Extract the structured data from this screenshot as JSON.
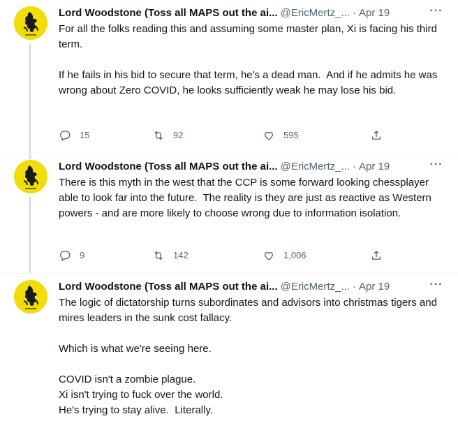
{
  "tweets": [
    {
      "author_name": "Lord Woodstone (Toss all MAPS out the ai...",
      "handle": "@EricMertz_...",
      "separator": "·",
      "time": "Apr 19",
      "more": "···",
      "text": "For all the folks reading this and assuming some master plan, Xi is facing his third term.\n\nIf he fails in his bid to secure that term, he's a dead man.  And if he admits he was wrong about Zero COVID, he looks sufficiently weak he may lose his bid.",
      "replies": "15",
      "retweets": "92",
      "likes": "595"
    },
    {
      "author_name": "Lord Woodstone (Toss all MAPS out the ai...",
      "handle": "@EricMertz_...",
      "separator": "·",
      "time": "Apr 19",
      "more": "···",
      "text": "There is this myth in the west that the CCP is some forward looking chessplayer able to look far into the future.  The reality is they are just as reactive as Western powers - and are more likely to choose wrong due to information isolation.",
      "replies": "9",
      "retweets": "142",
      "likes": "1,006"
    },
    {
      "author_name": "Lord Woodstone (Toss all MAPS out the ai...",
      "handle": "@EricMertz_...",
      "separator": "·",
      "time": "Apr 19",
      "more": "···",
      "text": "The logic of dictatorship turns subordinates and advisors into christmas tigers and mires leaders in the sunk cost fallacy.\n\nWhich is what we're seeing here.\n\nCOVID isn't a zombie plague.\nXi isn't trying to fuck over the world.\nHe's trying to stay alive.  Literally."
    }
  ],
  "colors": {
    "avatar_bg": "#f0dd0a",
    "secondary_text": "#536471",
    "thread_line": "#cfd9de"
  },
  "icons": [
    "reply-icon",
    "retweet-icon",
    "like-icon",
    "share-icon",
    "more-icon"
  ]
}
